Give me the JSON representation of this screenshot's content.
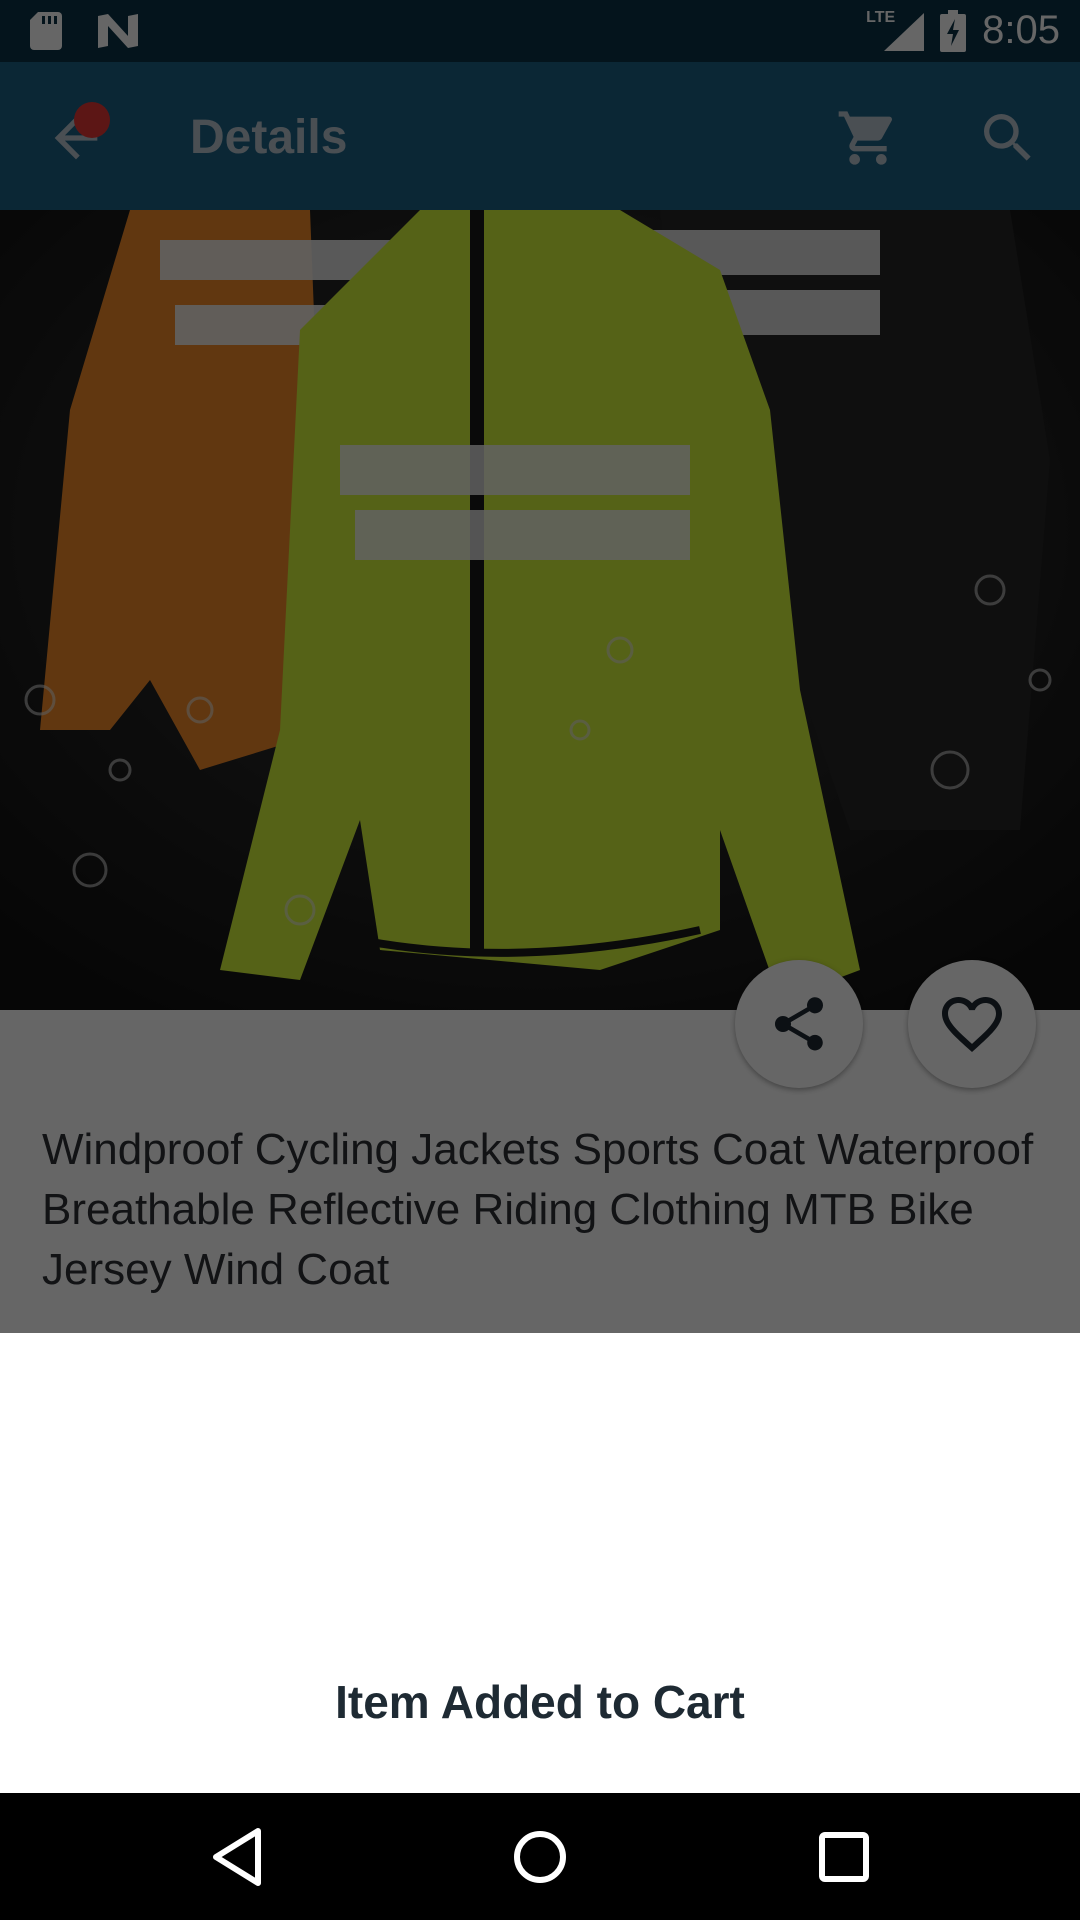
{
  "status_bar": {
    "time": "8:05",
    "network": "LTE",
    "icons": [
      "sd-card-icon",
      "n-logo-icon",
      "signal-icon",
      "battery-charging-icon"
    ]
  },
  "app_bar": {
    "title": "Details",
    "icons": [
      "back-arrow-icon",
      "cart-icon",
      "search-icon"
    ],
    "accent_color": "#1d6186",
    "badge_color": "#e53935"
  },
  "product": {
    "title": "Windproof Cycling Jackets Sports Coat Waterproof Breathable Reflective Riding Clothing MTB Bike Jersey Wind Coat",
    "actions": [
      "share-icon",
      "heart-icon"
    ]
  },
  "snackbar": {
    "message": "Item Added to Cart"
  },
  "nav_bar": {
    "icons": [
      "back-triangle-icon",
      "home-circle-icon",
      "recents-square-icon"
    ]
  }
}
